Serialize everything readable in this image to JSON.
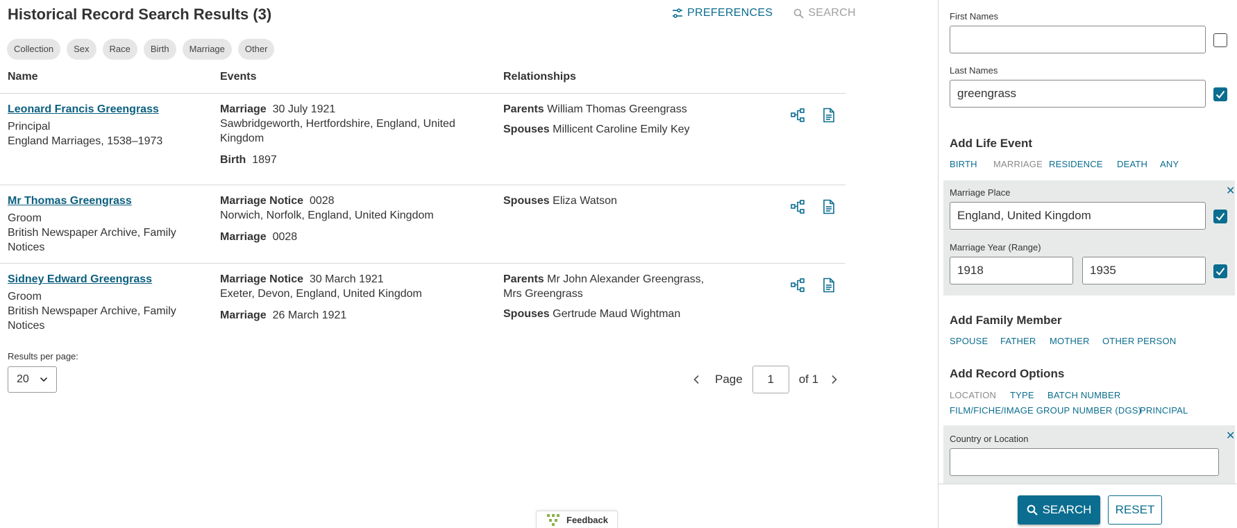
{
  "header": {
    "title": "Historical Record Search Results (3)",
    "preferences_label": "PREFERENCES",
    "search_label": "SEARCH"
  },
  "filters": [
    "Collection",
    "Sex",
    "Race",
    "Birth",
    "Marriage",
    "Other"
  ],
  "columns": {
    "name": "Name",
    "events": "Events",
    "relationships": "Relationships"
  },
  "results": [
    {
      "name": "Leonard Francis Greengrass",
      "role": "Principal",
      "collection": "England Marriages, 1538–1973",
      "events": [
        {
          "type": "Marriage",
          "date": "30 July 1921",
          "place": "Sawbridgeworth, Hertfordshire, England, United Kingdom"
        },
        {
          "type": "Birth",
          "date": "1897",
          "place": ""
        }
      ],
      "relationships": [
        {
          "type": "Parents",
          "value": "William Thomas Greengrass"
        },
        {
          "type": "Spouses",
          "value": "Millicent Caroline Emily Key"
        }
      ]
    },
    {
      "name": "Mr Thomas Greengrass",
      "role": "Groom",
      "collection": "British Newspaper Archive, Family Notices",
      "events": [
        {
          "type": "Marriage Notice",
          "date": "0028",
          "place": "Norwich, Norfolk, England, United Kingdom"
        },
        {
          "type": "Marriage",
          "date": "0028",
          "place": ""
        }
      ],
      "relationships": [
        {
          "type": "Spouses",
          "value": "Eliza Watson"
        }
      ]
    },
    {
      "name": "Sidney Edward Greengrass",
      "role": "Groom",
      "collection": "British Newspaper Archive, Family Notices",
      "events": [
        {
          "type": "Marriage Notice",
          "date": "30 March 1921",
          "place": "Exeter, Devon, England, United Kingdom"
        },
        {
          "type": "Marriage",
          "date": "26 March 1921",
          "place": ""
        }
      ],
      "relationships": [
        {
          "type": "Parents",
          "value": "Mr John Alexander Greengrass, Mrs Greengrass"
        },
        {
          "type": "Spouses",
          "value": "Gertrude Maud Wightman"
        }
      ]
    }
  ],
  "pagination": {
    "results_per_page_label": "Results per page:",
    "results_per_page": "20",
    "page_label": "Page",
    "page": "1",
    "of_label": "of 1"
  },
  "feedback_label": "Feedback",
  "side": {
    "first_names_label": "First Names",
    "first_names_value": "",
    "first_names_exact": false,
    "last_names_label": "Last Names",
    "last_names_value": "greengrass",
    "last_names_exact": true,
    "life_event_title": "Add Life Event",
    "life_events": [
      "BIRTH",
      "MARRIAGE",
      "RESIDENCE",
      "DEATH",
      "ANY"
    ],
    "marriage_place_label": "Marriage Place",
    "marriage_place_value": "England, United Kingdom",
    "marriage_year_label": "Marriage Year (Range)",
    "marriage_year_from": "1918",
    "marriage_year_to": "1935",
    "family_member_title": "Add Family Member",
    "family_members": [
      "SPOUSE",
      "FATHER",
      "MOTHER",
      "OTHER PERSON"
    ],
    "record_options_title": "Add Record Options",
    "record_options": [
      "LOCATION",
      "TYPE",
      "BATCH NUMBER",
      "FILM/FICHE/IMAGE GROUP NUMBER (DGS)",
      "PRINCIPAL"
    ],
    "country_label": "Country or Location",
    "country_value": "",
    "search_button": "SEARCH",
    "reset_button": "RESET"
  },
  "colors": {
    "accent": "#0b6d8f",
    "link": "#0b5f7f",
    "chip_bg": "#e6e6e6",
    "panel_bg": "#e8eaea"
  }
}
